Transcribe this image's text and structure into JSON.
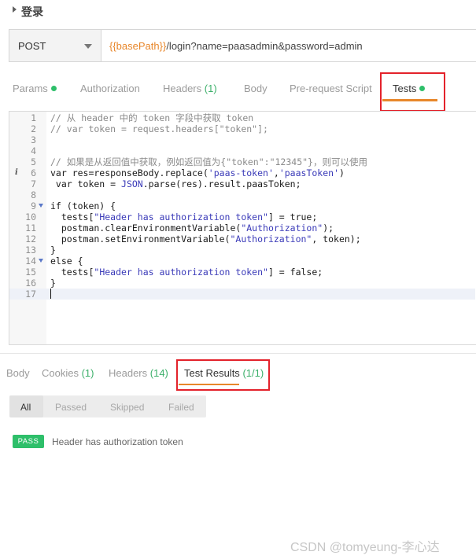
{
  "request": {
    "name": "登录"
  },
  "url_bar": {
    "method": "POST",
    "url_variable": "{{basePath}}",
    "url_rest": "/login?name=paasadmin&password=admin"
  },
  "request_tabs": [
    {
      "label": "Params",
      "dot": true
    },
    {
      "label": "Authorization"
    },
    {
      "label": "Headers",
      "count": "(1)"
    },
    {
      "label": "Body"
    },
    {
      "label": "Pre-request Script"
    },
    {
      "label": "Tests",
      "dot": true,
      "active": true
    }
  ],
  "editor": {
    "lines": [
      {
        "n": "1",
        "html": "<span class='cm'>// 从 header 中的 token 字段中获取 token</span>"
      },
      {
        "n": "2",
        "html": "<span class='cm'>// var token = request.headers[\"token\"];</span>"
      },
      {
        "n": "3",
        "html": ""
      },
      {
        "n": "4",
        "html": ""
      },
      {
        "n": "5",
        "html": "<span class='cm'>// 如果是从返回值中获取，例如返回值为{\"token\":\"12345\"}，则可以使用</span>"
      },
      {
        "n": "6",
        "info": true,
        "html": "var res=responseBody.replace(<span class='str'>'paas-token'</span>,<span class='str'>'paasToken'</span>)"
      },
      {
        "n": "7",
        "html": " var token = <span class='str'>JSON</span>.parse(res).result.paasToken;"
      },
      {
        "n": "8",
        "html": ""
      },
      {
        "n": "9",
        "fold": true,
        "html": "if (token) {"
      },
      {
        "n": "10",
        "html": "  tests[<span class='str'>\"Header has authorization token\"</span>] = true;"
      },
      {
        "n": "11",
        "html": "  postman.clearEnvironmentVariable(<span class='str'>\"Authorization\"</span>);"
      },
      {
        "n": "12",
        "html": "  postman.setEnvironmentVariable(<span class='str'>\"Authorization\"</span>, token);"
      },
      {
        "n": "13",
        "html": "}"
      },
      {
        "n": "14",
        "fold": true,
        "html": "else {"
      },
      {
        "n": "15",
        "html": "  tests[<span class='str'>\"Header has authorization token\"</span>] = false;"
      },
      {
        "n": "16",
        "html": "}"
      },
      {
        "n": "17",
        "active": true,
        "html": ""
      }
    ]
  },
  "response_tabs": [
    {
      "label": "Body"
    },
    {
      "label": "Cookies",
      "count": "(1)"
    },
    {
      "label": "Headers",
      "count": "(14)"
    },
    {
      "label": "Test Results",
      "count": "(1/1)",
      "active": true
    }
  ],
  "filters": [
    "All",
    "Passed",
    "Skipped",
    "Failed"
  ],
  "results": [
    {
      "status": "PASS",
      "name": "Header has authorization token"
    }
  ],
  "watermark": "CSDN @tomyeung-李心达",
  "colors": {
    "accent": "#e8872b",
    "pass": "#2ebf6a",
    "highlight_box": "#e3222b"
  }
}
